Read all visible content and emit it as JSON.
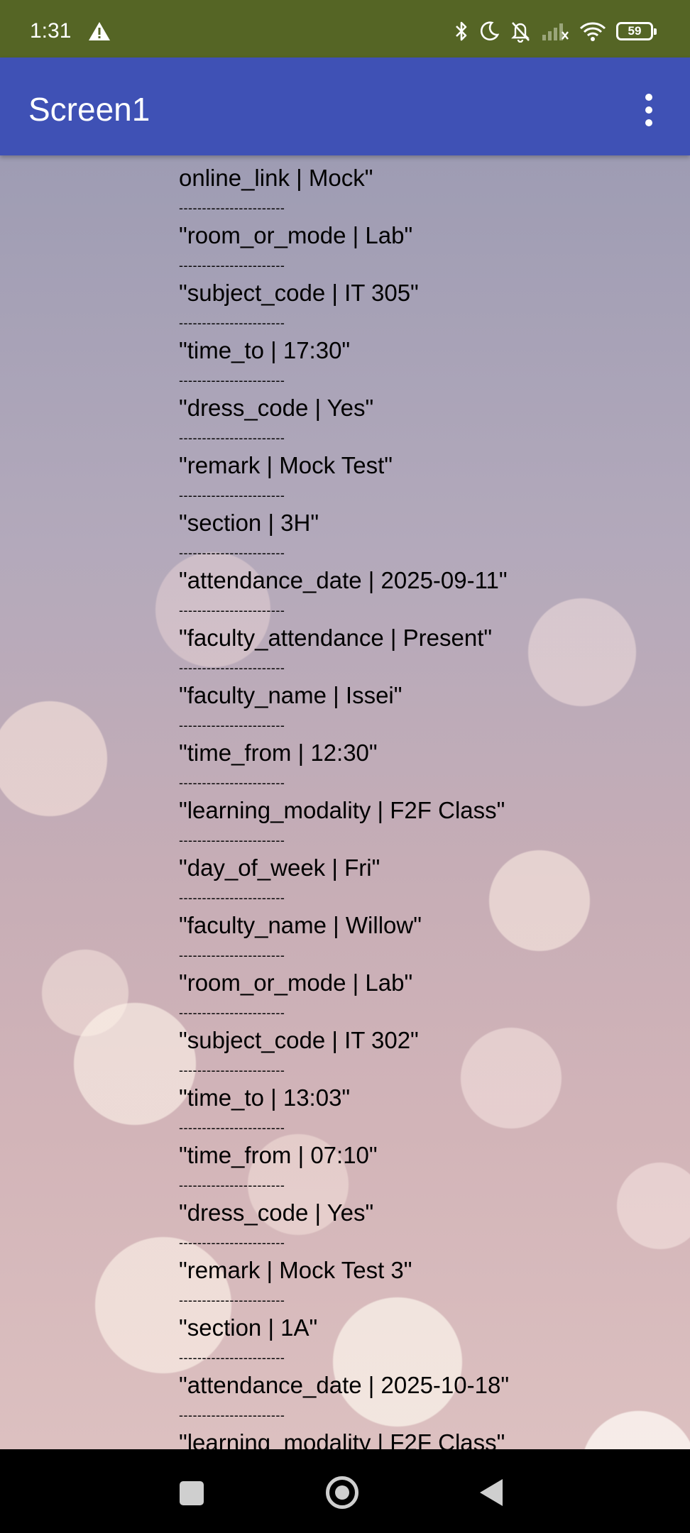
{
  "status_bar": {
    "time": "1:31",
    "battery": "59",
    "icons": [
      "warning-icon",
      "bluetooth-icon",
      "do-not-disturb-icon",
      "notifications-off-icon",
      "signal-icon",
      "wifi-icon",
      "battery-icon"
    ]
  },
  "app_bar": {
    "title": "Screen1",
    "color": "#3f51b5",
    "menu_icon": "more-vert-icon"
  },
  "separator": "-----------------------",
  "records": [
    "online_link | Mock\"",
    "\"room_or_mode | Lab\"",
    "\"subject_code | IT 305\"",
    "\"time_to | 17:30\"",
    "\"dress_code | Yes\"",
    "\"remark | Mock Test\"",
    "\"section | 3H\"",
    "\"attendance_date | 2025-09-11\"",
    "\"faculty_attendance | Present\"",
    "\"faculty_name | Issei\"",
    "\"time_from | 12:30\"",
    "\"learning_modality | F2F Class\"",
    "\"day_of_week | Fri\"",
    "\"faculty_name | Willow\"",
    "\"room_or_mode | Lab\"",
    "\"subject_code | IT 302\"",
    "\"time_to | 13:03\"",
    "\"time_from | 07:10\"",
    "\"dress_code | Yes\"",
    "\"remark | Mock Test 3\"",
    "\"section | 1A\"",
    "\"attendance_date | 2025-10-18\"",
    "\"learning_modality | F2F Class\""
  ],
  "nav_bar": {
    "icons": [
      "recent-apps-icon",
      "home-icon",
      "back-icon"
    ]
  }
}
